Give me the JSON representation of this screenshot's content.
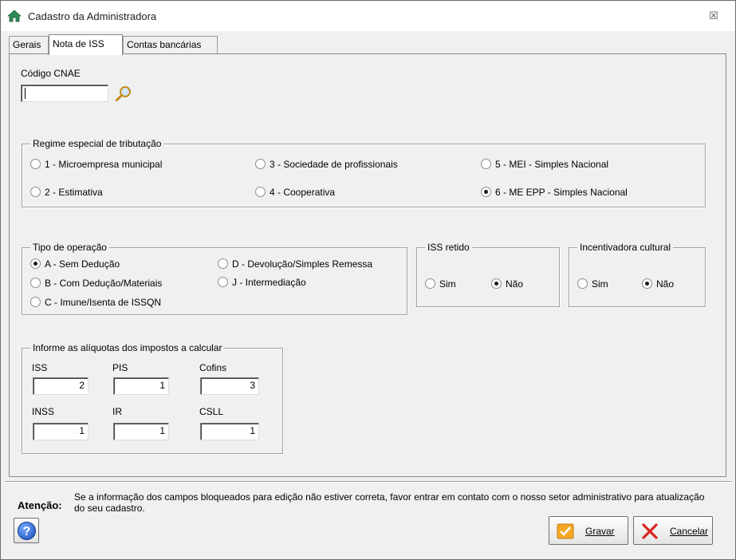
{
  "window": {
    "title": "Cadastro da Administradora",
    "close_glyph": "☒"
  },
  "tabs": [
    {
      "label": "Gerais"
    },
    {
      "label": "Nota de ISS",
      "active": true
    },
    {
      "label": "Contas bancárias"
    }
  ],
  "cnae": {
    "label": "Código CNAE",
    "value": "",
    "search_icon": "magnifier-icon"
  },
  "regime": {
    "legend": "Regime especial de tributação",
    "options": [
      {
        "label": "1 - Microempresa municipal",
        "checked": false
      },
      {
        "label": "2 - Estimativa",
        "checked": false
      },
      {
        "label": "3 - Sociedade de profissionais",
        "checked": false
      },
      {
        "label": "4 - Cooperativa",
        "checked": false
      },
      {
        "label": "5 - MEI - Simples Nacional",
        "checked": false
      },
      {
        "label": "6 - ME EPP - Simples Nacional",
        "checked": true
      }
    ]
  },
  "operacao": {
    "legend": "Tipo de operação",
    "options": [
      {
        "label": "A - Sem Dedução",
        "checked": true
      },
      {
        "label": "B - Com Dedução/Materiais",
        "checked": false
      },
      {
        "label": "C - Imune/Isenta de ISSQN",
        "checked": false
      },
      {
        "label": "D - Devolução/Simples Remessa",
        "checked": false
      },
      {
        "label": "J - Intermediação",
        "checked": false
      }
    ]
  },
  "iss_retido": {
    "legend": "ISS retido",
    "sim": "Sim",
    "nao": "Não",
    "selected": "nao"
  },
  "incentivadora": {
    "legend": "Incentivadora cultural",
    "sim": "Sim",
    "nao": "Não",
    "selected": "nao"
  },
  "aliquotas": {
    "legend": "Informe as alíquotas dos impostos a calcular",
    "fields": [
      {
        "label": "ISS",
        "value": "2"
      },
      {
        "label": "PIS",
        "value": "1"
      },
      {
        "label": "Cofins",
        "value": "3"
      },
      {
        "label": "INSS",
        "value": "1"
      },
      {
        "label": "IR",
        "value": "1"
      },
      {
        "label": "CSLL",
        "value": "1"
      }
    ]
  },
  "footer": {
    "attention_label": "Atenção:",
    "attention_text": "Se a informação dos campos bloqueados para edição não estiver correta, favor entrar em contato com o nosso setor administrativo para atualização do seu cadastro.",
    "help_glyph": "?",
    "save_label": "Gravar",
    "cancel_label": "Cancelar"
  },
  "colors": {
    "accent_check": "#f5a623",
    "cancel_x": "#d9261c",
    "home_icon": "#2e8b57"
  }
}
